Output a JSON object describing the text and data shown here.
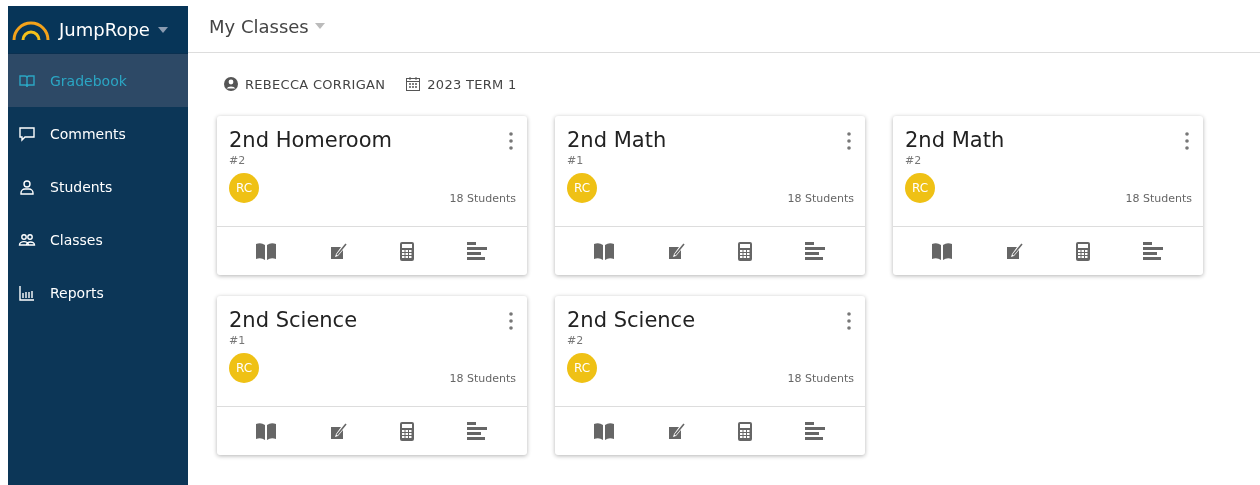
{
  "brand": {
    "name": "JumpRope"
  },
  "nav": [
    {
      "label": "Gradebook",
      "kind": "book",
      "selected": true
    },
    {
      "label": "Comments",
      "kind": "comment",
      "selected": false
    },
    {
      "label": "Students",
      "kind": "person",
      "selected": false
    },
    {
      "label": "Classes",
      "kind": "people",
      "selected": false
    },
    {
      "label": "Reports",
      "kind": "chart",
      "selected": false
    }
  ],
  "header": {
    "title": "My Classes"
  },
  "meta": {
    "teacher": "REBECCA CORRIGAN",
    "term": "2023 TERM 1"
  },
  "classes": [
    {
      "name": "2nd Homeroom",
      "section": "#2",
      "initials": "RC",
      "students": "18 Students"
    },
    {
      "name": "2nd Math",
      "section": "#1",
      "initials": "RC",
      "students": "18 Students"
    },
    {
      "name": "2nd Math",
      "section": "#2",
      "initials": "RC",
      "students": "18 Students"
    },
    {
      "name": "2nd Science",
      "section": "#1",
      "initials": "RC",
      "students": "18 Students"
    },
    {
      "name": "2nd Science",
      "section": "#2",
      "initials": "RC",
      "students": "18 Students"
    }
  ]
}
